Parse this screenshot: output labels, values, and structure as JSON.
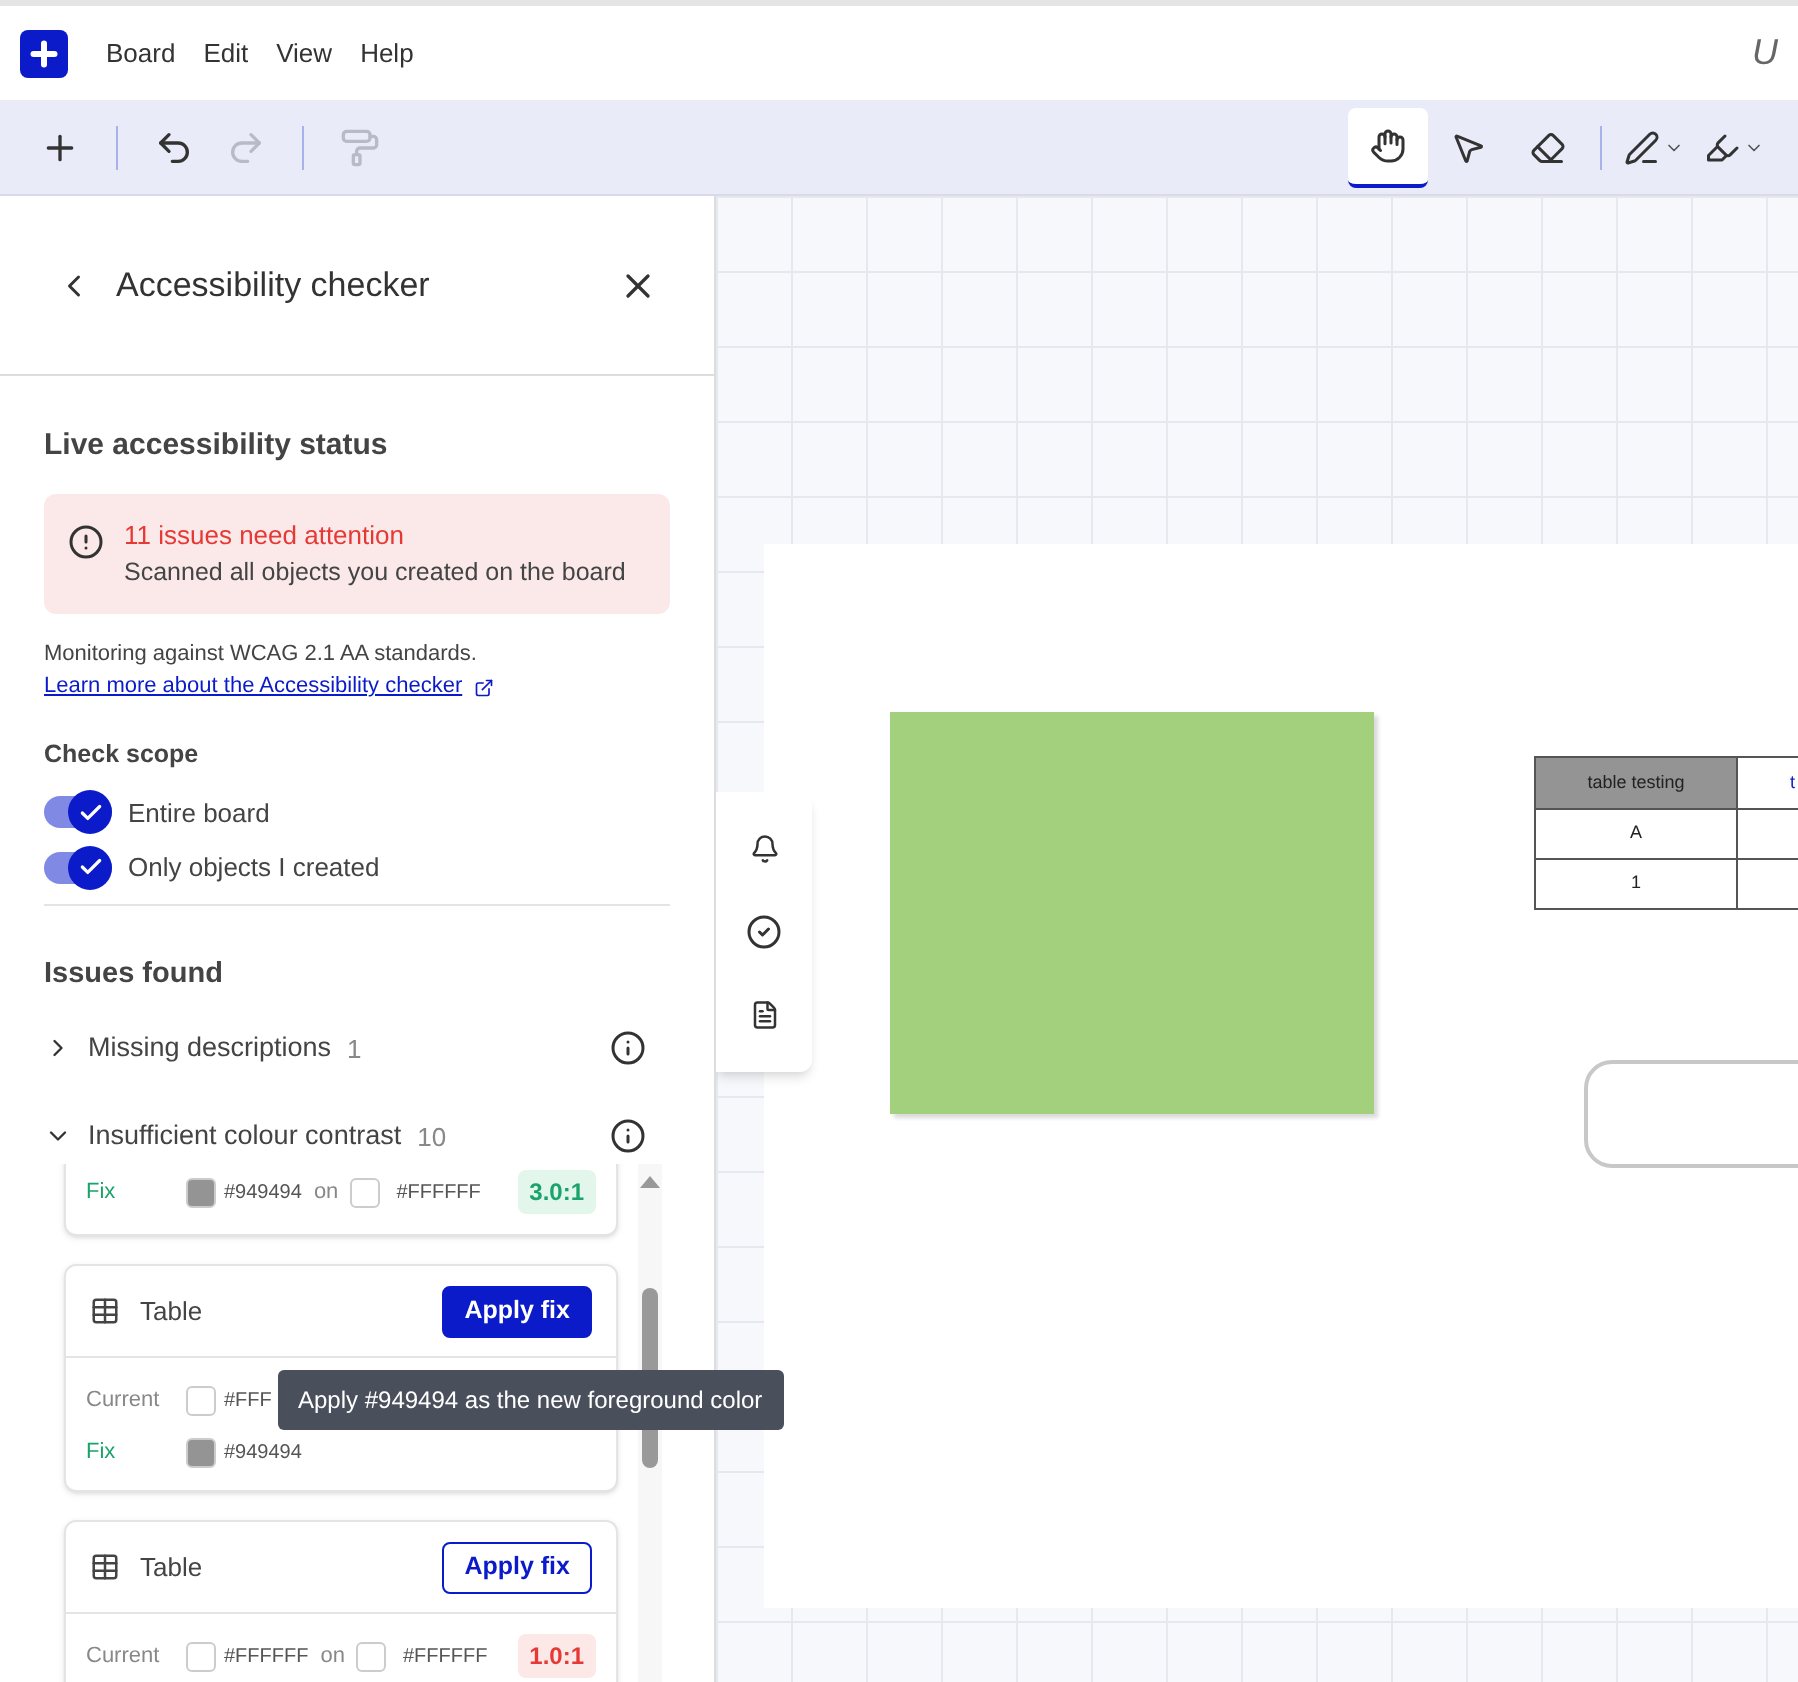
{
  "menu_bar": {
    "menus": [
      "Board",
      "Edit",
      "View",
      "Help"
    ],
    "title": "U"
  },
  "toolbar": {
    "actions": [
      {
        "kind": "add",
        "disabled": false
      },
      {
        "kind": "undo",
        "disabled": false
      },
      {
        "kind": "redo",
        "disabled": true
      },
      {
        "kind": "paint",
        "disabled": true
      }
    ],
    "tools": [
      {
        "kind": "hand",
        "selected": true
      },
      {
        "kind": "pointer",
        "selected": false
      },
      {
        "kind": "eraser",
        "selected": false
      },
      {
        "kind": "pen",
        "selected": false
      },
      {
        "kind": "highlighter",
        "selected": false
      }
    ]
  },
  "panel": {
    "title": "Accessibility checker",
    "status_heading": "Live accessibility status",
    "alert": {
      "title": "11 issues need attention",
      "text": "Scanned all objects you created on the board"
    },
    "monitoring": "Monitoring against WCAG 2.1 AA standards.",
    "link": "Learn more about the Accessibility checker",
    "scope_heading": "Check scope",
    "toggles": [
      {
        "label": "Entire board",
        "on": true
      },
      {
        "label": "Only objects I created",
        "on": true
      }
    ],
    "issues_heading": "Issues found",
    "categories": [
      {
        "label": "Missing descriptions",
        "count": "1",
        "expanded": false
      },
      {
        "label": "Insufficient colour contrast",
        "count": "10",
        "expanded": true
      }
    ],
    "cards": [
      {
        "rows": [
          {
            "kind": "fix",
            "label": "Fix",
            "fg": "#949494",
            "on": "on",
            "bg": "#FFFFFF",
            "ratio": "3.0:1"
          }
        ]
      },
      {
        "title": "Table",
        "button": "Apply fix",
        "button_selected": true,
        "rows": [
          {
            "kind": "current",
            "label": "Current",
            "fg": "#FFF"
          },
          {
            "kind": "fix",
            "label": "Fix",
            "fg": "#949494"
          }
        ]
      },
      {
        "title": "Table",
        "button": "Apply fix",
        "button_selected": false,
        "rows": [
          {
            "kind": "current",
            "label": "Current",
            "fg": "#FFFFFF",
            "on": "on",
            "bg": "#FFFFFF",
            "ratio": "1.0:1"
          }
        ]
      }
    ],
    "tooltip": "Apply #949494 as the new foreground color"
  },
  "canvas": {
    "table": {
      "header": [
        "table testing",
        "t"
      ],
      "rows": [
        [
          "A"
        ],
        [
          "1"
        ]
      ]
    }
  }
}
